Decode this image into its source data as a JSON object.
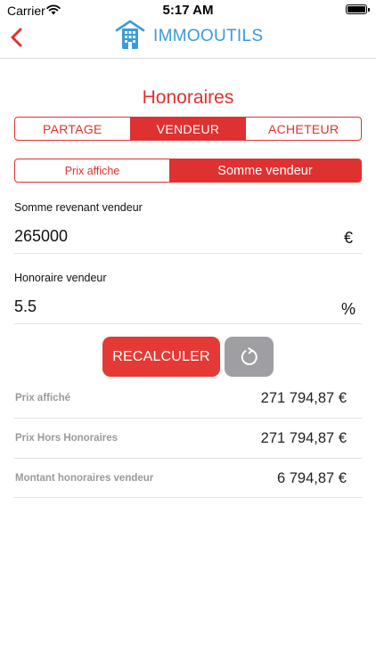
{
  "status_bar": {
    "carrier": "Carrier",
    "time": "5:17 AM",
    "icons": [
      "wifi-icon",
      "battery-icon"
    ]
  },
  "nav": {
    "back_icon": "chevron-left-icon",
    "logo_icon": "building-logo-icon",
    "brand": "IMMOOUTILS"
  },
  "page": {
    "title": "Honoraires"
  },
  "segment_party": {
    "options": [
      "PARTAGE",
      "VENDEUR",
      "ACHETEUR"
    ],
    "selected": "VENDEUR"
  },
  "segment_mode": {
    "options": [
      "Prix affiche",
      "Somme vendeur"
    ],
    "selected": "Somme vendeur"
  },
  "fields": [
    {
      "label": "Somme revenant vendeur",
      "value": "265000",
      "unit": "€"
    },
    {
      "label": "Honoraire vendeur",
      "value": "5.5",
      "unit": "%"
    }
  ],
  "actions": {
    "recalc_label": "RECALCULER",
    "reset_icon": "refresh-icon"
  },
  "results": [
    {
      "label": "Prix affiché",
      "value": "271 794,87 €"
    },
    {
      "label": "Prix Hors Honoraires",
      "value": "271 794,87 €"
    },
    {
      "label": "Montant honoraires vendeur",
      "value": "6 794,87 €"
    }
  ],
  "colors": {
    "accent": "#e03131",
    "brand": "#3a9bd9",
    "reset_button": "#9e9ea3"
  }
}
